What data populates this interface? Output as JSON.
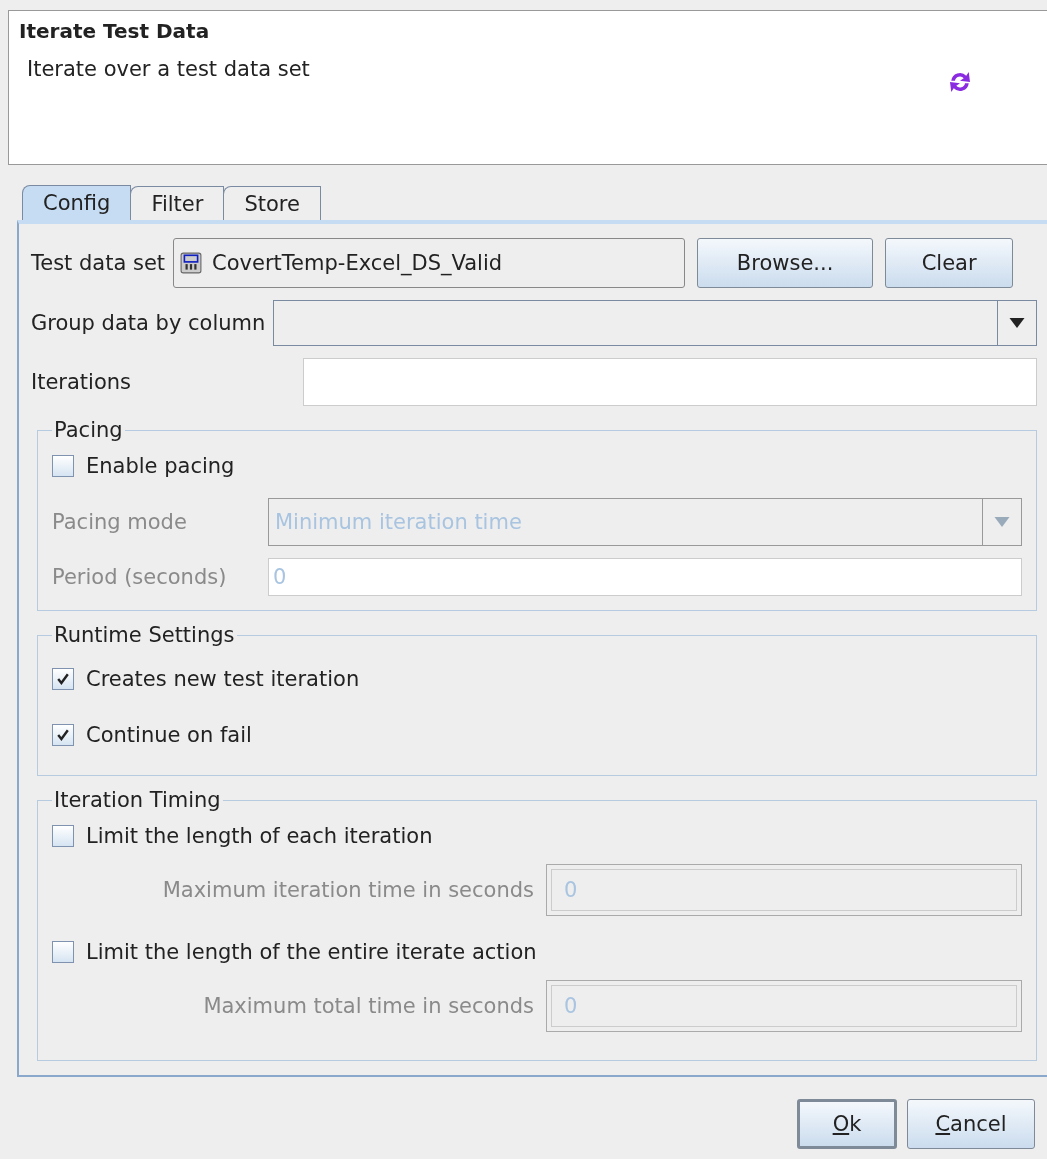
{
  "header": {
    "title": "Iterate Test Data",
    "description": "Iterate over a test data set"
  },
  "tabs": [
    {
      "label": "Config",
      "selected": true
    },
    {
      "label": "Filter",
      "selected": false
    },
    {
      "label": "Store",
      "selected": false
    }
  ],
  "test_data_set": {
    "label": "Test data set",
    "value": "CovertTemp-Excel_DS_Valid",
    "buttons": [
      "Browse...",
      "Clear"
    ]
  },
  "group_by": {
    "label": "Group data by column"
  },
  "iterations": {
    "label": "Iterations"
  },
  "pacing": {
    "title": "Pacing",
    "enable": {
      "label": "Enable pacing",
      "checked": false
    },
    "mode": {
      "label": "Pacing mode",
      "value": "Minimum iteration time",
      "disabled": true
    },
    "period": {
      "label": "Period (seconds)",
      "value": "0",
      "disabled": true
    }
  },
  "runtime": {
    "title": "Runtime Settings",
    "options": [
      {
        "label": "Creates new test iteration",
        "checked": true
      },
      {
        "label": "Continue on fail",
        "checked": true
      }
    ]
  },
  "timing": {
    "title": "Iteration Timing",
    "limits": [
      {
        "label": "Limit the length of each iteration",
        "checked": false,
        "sub_label": "Maximum iteration time in seconds",
        "value": "0",
        "disabled": true
      },
      {
        "label": "Limit the length of the entire iterate action",
        "checked": false,
        "sub_label": "Maximum total time in seconds",
        "value": "0",
        "disabled": true
      }
    ]
  },
  "buttons": [
    {
      "label": "Ok",
      "default": true,
      "mnemonic_first": true
    },
    {
      "label": "Cancel",
      "default": false,
      "mnemonic_first": true
    }
  ]
}
